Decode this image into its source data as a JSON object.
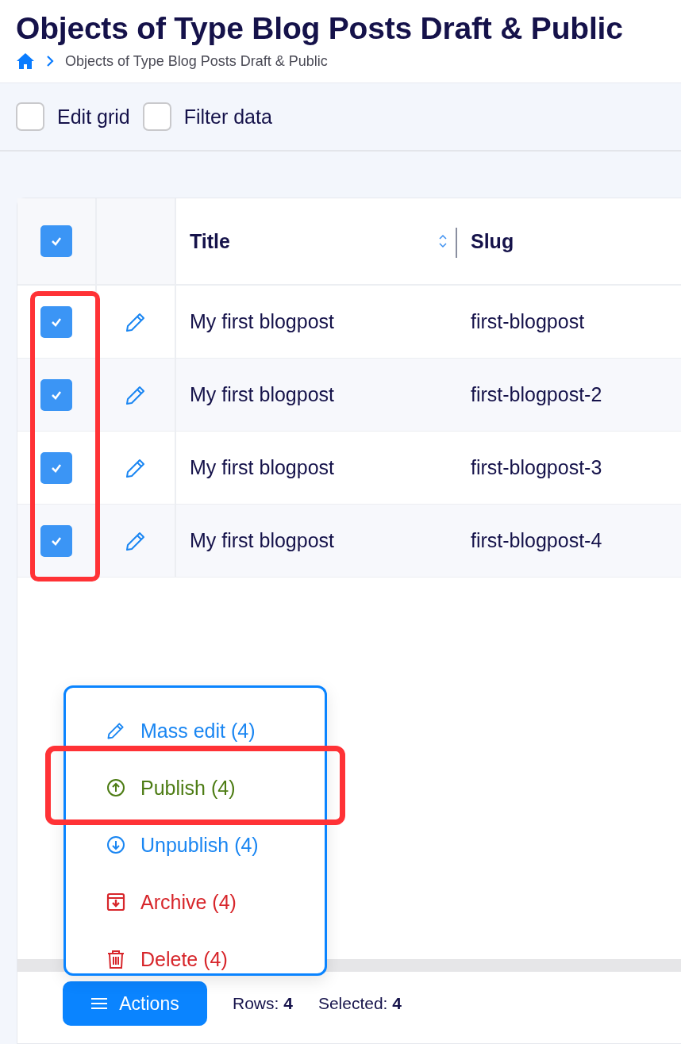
{
  "page": {
    "title": "Objects of Type Blog Posts Draft & Public"
  },
  "breadcrumb": [
    "Objects of Type Blog Posts Draft & Public"
  ],
  "toolbar": [
    {
      "label": "Edit grid",
      "checked": false
    },
    {
      "label": "Filter data",
      "checked": false
    }
  ],
  "table": {
    "select_all_checked": true,
    "checkbox_column_highlighted": true,
    "columns": [
      {
        "label": "Title",
        "sortable": true
      },
      {
        "label": "Slug",
        "sortable": false
      }
    ],
    "rows": [
      {
        "checked": true,
        "cells": [
          "My first blogpost",
          "first-blogpost"
        ]
      },
      {
        "checked": true,
        "cells": [
          "My first blogpost",
          "first-blogpost-2"
        ]
      },
      {
        "checked": true,
        "cells": [
          "My first blogpost",
          "first-blogpost-3"
        ]
      },
      {
        "checked": true,
        "cells": [
          "My first blogpost",
          "first-blogpost-4"
        ]
      }
    ]
  },
  "actions_menu": {
    "open": true,
    "items": [
      {
        "kind": "edit",
        "label": "Mass edit (4)",
        "highlighted": false
      },
      {
        "kind": "publish",
        "label": "Publish (4)",
        "highlighted": true
      },
      {
        "kind": "unpublish",
        "label": "Unpublish (4)",
        "highlighted": false
      },
      {
        "kind": "archive",
        "label": "Archive (4)",
        "highlighted": false
      },
      {
        "kind": "delete",
        "label": "Delete (4)",
        "highlighted": false
      }
    ]
  },
  "footer": {
    "button": "Actions",
    "rows_label": "Rows:",
    "rows_value": "4",
    "selected_label": "Selected:",
    "selected_value": "4"
  }
}
